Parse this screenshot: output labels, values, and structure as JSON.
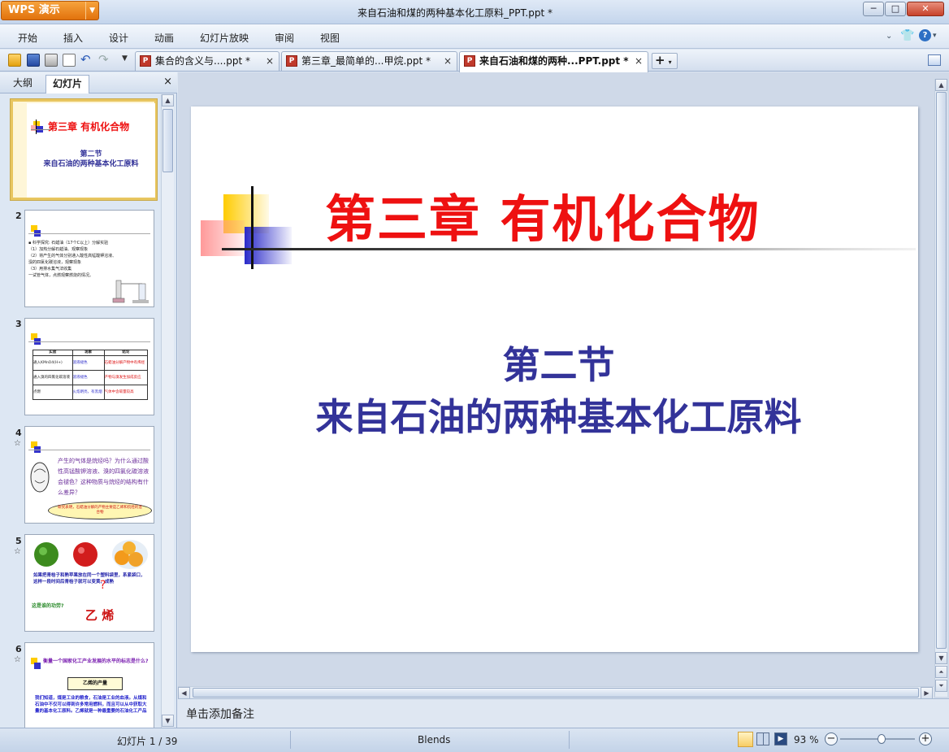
{
  "titlebar": {
    "app_name": "WPS 演示",
    "window_title": "来自石油和煤的两种基本化工原料_PPT.ppt *",
    "minimize": "─",
    "maximize": "□",
    "close": "✕"
  },
  "menubar": {
    "items": [
      "开始",
      "插入",
      "设计",
      "动画",
      "幻灯片放映",
      "审阅",
      "视图"
    ]
  },
  "tabs": [
    {
      "label": "集合的含义与....ppt *",
      "close": "×"
    },
    {
      "label": "第三章_最简单的...甲烷.ppt *",
      "close": "×"
    },
    {
      "label": "来自石油和煤的两种...PPT.ppt *",
      "close": "×"
    }
  ],
  "new_tab": "+",
  "pane": {
    "tab_outline": "大纲",
    "tab_slides": "幻灯片",
    "close": "×"
  },
  "thumbnails": [
    {
      "num": "1",
      "title": "第三章  有机化合物",
      "sub1": "第二节",
      "sub2": "来自石油的两种基本化工原料"
    },
    {
      "num": "2",
      "lines": [
        "▪ 科学探究: 石蜡油（17个C以上）分解实验",
        "（1）加热分解石蜡油、观察现象",
        "（2）将产生的气体分别通入酸性高锰酸钾溶液、",
        "溴的四氯化碳溶液，观察现象",
        "（3）用排水集气法收集",
        "一试管气体，点燃观察燃烧的情况。"
      ]
    },
    {
      "num": "3",
      "table": [
        [
          "实验",
          "现象",
          "结论"
        ],
        [
          "通入KMnO4(H+)",
          "溶液褪色",
          "石蜡油分解产物中有烯烃"
        ],
        [
          "通入溴的四氯化碳溶液",
          "溶液褪色",
          "产物与溴发生加成反应"
        ],
        [
          "点燃",
          "火焰明亮，有黑烟",
          "气体中含碳量较高"
        ]
      ]
    },
    {
      "num": "4",
      "star": "☆",
      "text": "产生的气体是烷烃吗？为什么通过酸性高锰酸钾溶液、溴的四氯化碳溶液会褪色？这种物质与烷烃的结构有什么差异？",
      "bubble": "研究表明，石蜡油分解的产物主要是乙烯和烷烃的混合物"
    },
    {
      "num": "5",
      "star": "☆",
      "text": "如果把青桔子和熟苹果放在同一个塑料袋里，系紧袋口，这样一段时间后青桔子就可以变黄、成熟",
      "q": "这是谁的功劳?",
      "answer": "乙  烯"
    },
    {
      "num": "6",
      "star": "☆",
      "text": "衡量一个国家化工产业发展的水平的标志是什么?",
      "box": "乙烯的产量",
      "body": "我们知道，煤是工业的粮食，石油是工业的血液。从煤和石油中不仅可以得到许多常用燃料，而且可以从中获取大量的基本化工原料。乙烯就是一种最重要的石油化工产品"
    }
  ],
  "slide": {
    "title": "第三章  有机化合物",
    "section": "第二节",
    "subtitle": "来自石油的两种基本化工原料"
  },
  "notes_placeholder": "单击添加备注",
  "status": {
    "slide_counter": "幻灯片 1 / 39",
    "theme": "Blends",
    "zoom": "93 %",
    "zoom_fraction": 0.55
  },
  "colors": {
    "title_red": "#ee1111",
    "subtitle_blue": "#333399",
    "logo_yellow": "#ffcc00",
    "logo_blue": "#3333cc",
    "logo_pink": "#ff9999"
  }
}
